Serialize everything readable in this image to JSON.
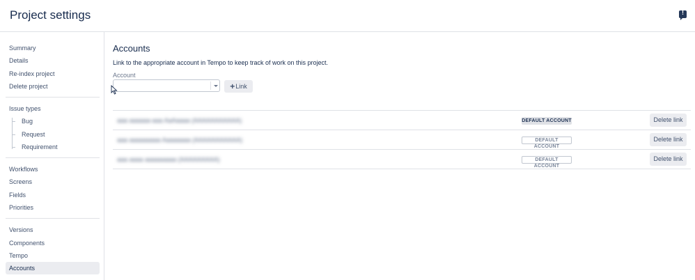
{
  "header": {
    "title": "Project settings",
    "feedback_icon": "feedback-icon",
    "feedback_glyph": "!"
  },
  "sidebar": {
    "group1": [
      "Summary",
      "Details",
      "Re-index project",
      "Delete project"
    ],
    "issue_types_label": "Issue types",
    "issue_types": [
      "Bug",
      "Request",
      "Requirement"
    ],
    "group3": [
      "Workflows",
      "Screens",
      "Fields",
      "Priorities"
    ],
    "group4": [
      "Versions",
      "Components",
      "Tempo",
      "Accounts"
    ],
    "selected": "Accounts"
  },
  "main": {
    "title": "Accounts",
    "description": "Link to the appropriate account in Tempo to keep track of work on this project.",
    "account_label": "Account",
    "account_value": "",
    "link_button": "Link",
    "plus_glyph": "+",
    "rows": [
      {
        "name": "aaa aaaaaa-aaa AaAaaaa (AAAAAAAAAAA)",
        "badge": "DEFAULT ACCOUNT",
        "is_default": true,
        "delete": "Delete link"
      },
      {
        "name": "aaa aaaaaaaaa Aaaaaaaa (AAAAAAAAAAA)",
        "badge": "DEFAULT ACCOUNT",
        "is_default": false,
        "delete": "Delete link"
      },
      {
        "name": "aaa aaaa aaaaaaaaa (AAAAAAAAA)",
        "badge": "DEFAULT ACCOUNT",
        "is_default": false,
        "delete": "Delete link"
      }
    ]
  },
  "colors": {
    "accent": "#172b4d",
    "border": "#dfe1e6",
    "selected_bg": "#ebecf0"
  }
}
